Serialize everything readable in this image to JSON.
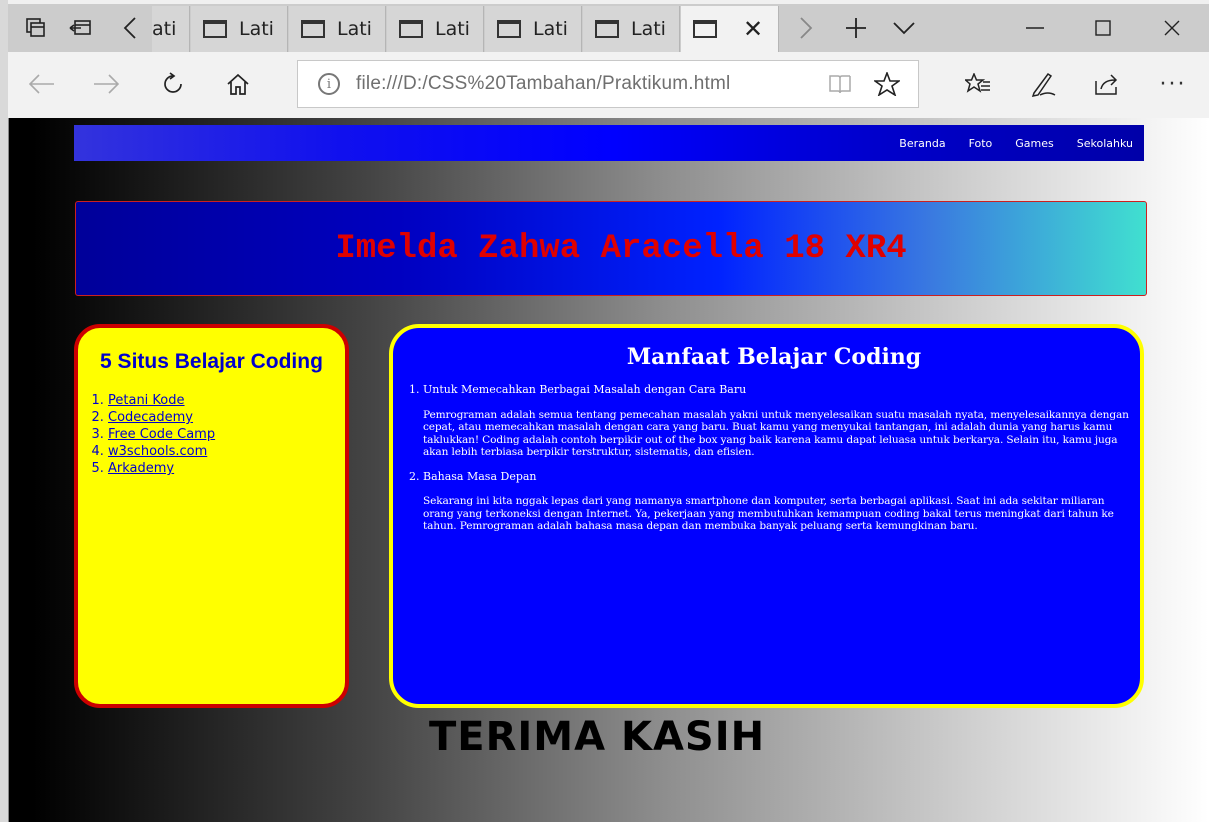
{
  "browser": {
    "tabs": [
      {
        "title": "Lati",
        "partial": "ati"
      },
      {
        "title": "Lati"
      },
      {
        "title": "Lati"
      },
      {
        "title": "Lati"
      },
      {
        "title": "Lati"
      },
      {
        "title": "Lati"
      },
      {
        "title": "",
        "active": true
      }
    ],
    "address": "file:///D:/CSS%20Tambahan/Praktikum.html",
    "icons": [
      "tab-preview-icon",
      "set-aside-tabs-icon",
      "scroll-left-icon",
      "scroll-right-icon",
      "new-tab-icon",
      "tab-dropdown-icon",
      "minimize-icon",
      "maximize-icon",
      "close-window-icon",
      "back-icon",
      "forward-icon",
      "refresh-icon",
      "home-icon",
      "info-icon",
      "reading-view-icon",
      "favorite-star-icon",
      "favorites-hub-icon",
      "web-note-icon",
      "share-icon",
      "more-icon"
    ]
  },
  "page": {
    "nav": [
      "Beranda",
      "Foto",
      "Games",
      "Sekolahku"
    ],
    "banner_title": "Imelda Zahwa Aracella 18 XR4",
    "left": {
      "title": "5 Situs Belajar Coding",
      "links": [
        "Petani Kode",
        "Codecademy",
        "Free Code Camp",
        "w3schools.com",
        "Arkademy"
      ]
    },
    "right": {
      "title": "Manfaat Belajar Coding",
      "items": [
        {
          "title": "Untuk Memecahkan Berbagai Masalah dengan Cara Baru",
          "text": "Pemrograman adalah semua tentang pemecahan masalah yakni untuk menyelesaikan suatu masalah nyata, menyelesaikannya dengan cepat, atau memecahkan masalah dengan cara yang baru. Buat kamu yang menyukai tantangan, ini adalah dunia yang harus kamu taklukkan! Coding adalah contoh berpikir out of the box yang baik karena kamu dapat leluasa untuk berkarya. Selain itu, kamu juga akan lebih terbiasa berpikir terstruktur, sistematis, dan efisien."
        },
        {
          "title": "Bahasa Masa Depan",
          "text": "Sekarang ini kita nggak lepas dari yang namanya smartphone dan komputer, serta berbagai aplikasi. Saat ini ada sekitar miliaran orang yang terkoneksi dengan Internet. Ya, pekerjaan yang membutuhkan kemampuan coding bakal terus meningkat dari tahun ke tahun. Pemrograman adalah bahasa masa depan dan membuka banyak peluang serta kemungkinan baru."
        }
      ]
    },
    "footer_text": "TERIMA KASIH"
  },
  "colors": {
    "nav_bg": "#0000ff",
    "banner_text": "#e00000",
    "left_bg": "#ffff00",
    "left_border": "#cc0000",
    "right_bg": "#0000ff",
    "right_border": "#ffff00"
  }
}
